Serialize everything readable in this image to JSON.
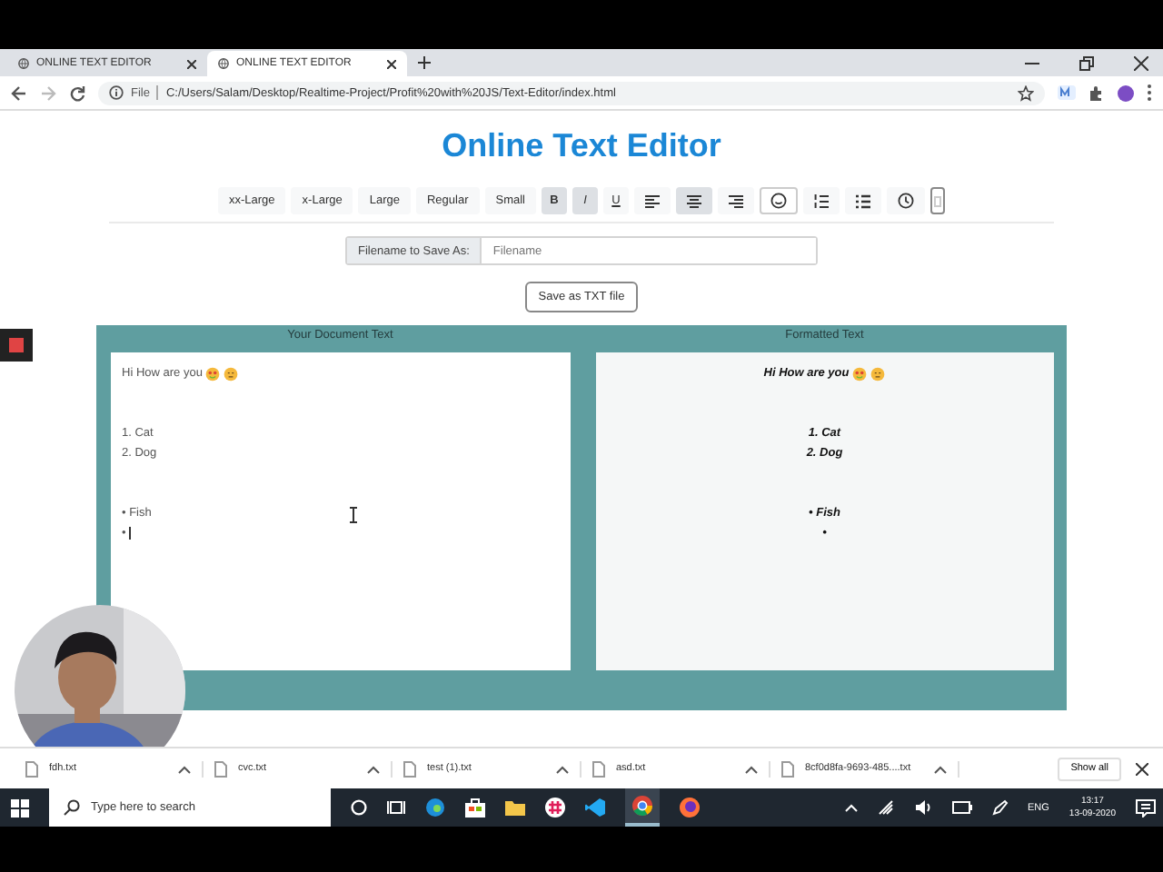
{
  "browser": {
    "tabs": [
      {
        "title": "ONLINE TEXT EDITOR",
        "selected": false
      },
      {
        "title": "ONLINE TEXT EDITOR",
        "selected": true
      }
    ],
    "address": {
      "scheme": "File",
      "url": "C:/Users/Salam/Desktop/Realtime-Project/Profit%20with%20JS/Text-Editor/index.html"
    }
  },
  "page": {
    "title": "Online Text Editor",
    "toolbar": [
      {
        "kind": "text",
        "label": "xx-Large",
        "selected": false
      },
      {
        "kind": "text",
        "label": "x-Large",
        "selected": false
      },
      {
        "kind": "text",
        "label": "Large",
        "selected": false
      },
      {
        "kind": "text",
        "label": "Regular",
        "selected": false
      },
      {
        "kind": "text",
        "label": "Small",
        "selected": false
      },
      {
        "kind": "bold",
        "label": "B",
        "selected": true
      },
      {
        "kind": "italic",
        "label": "I",
        "selected": true
      },
      {
        "kind": "underline",
        "label": "U",
        "selected": false
      },
      {
        "kind": "align-left",
        "selected": false
      },
      {
        "kind": "align-center",
        "selected": true
      },
      {
        "kind": "align-right",
        "selected": false
      },
      {
        "kind": "emoji",
        "selected": false
      },
      {
        "kind": "ordered-list",
        "selected": false
      },
      {
        "kind": "bullet-list",
        "selected": false
      },
      {
        "kind": "clock",
        "selected": false
      },
      {
        "kind": "swatch",
        "selected": false
      }
    ],
    "filename": {
      "label": "Filename to Save As:",
      "placeholder": "Filename"
    },
    "save_button": "Save as TXT file",
    "editor": {
      "heading": "Your Document Text",
      "paragraphs": [
        [
          "Hi How are you"
        ],
        [
          "1. Cat",
          "2. Dog"
        ],
        [
          "• Fish",
          "•"
        ]
      ]
    },
    "preview": {
      "heading": "Formatted Text",
      "paragraphs": [
        [
          "Hi How are you"
        ],
        [
          "1. Cat",
          "2. Dog"
        ],
        [
          "• Fish",
          "•"
        ]
      ]
    }
  },
  "downloads": {
    "files": [
      "fdh.txt",
      "cvc.txt",
      "test (1).txt",
      "asd.txt",
      "8cf0d8fa-9693-485....txt"
    ],
    "show_all": "Show all"
  },
  "taskbar": {
    "search_placeholder": "Type here to search",
    "language": "ENG",
    "time": "13:17",
    "date": "13-09-2020"
  }
}
